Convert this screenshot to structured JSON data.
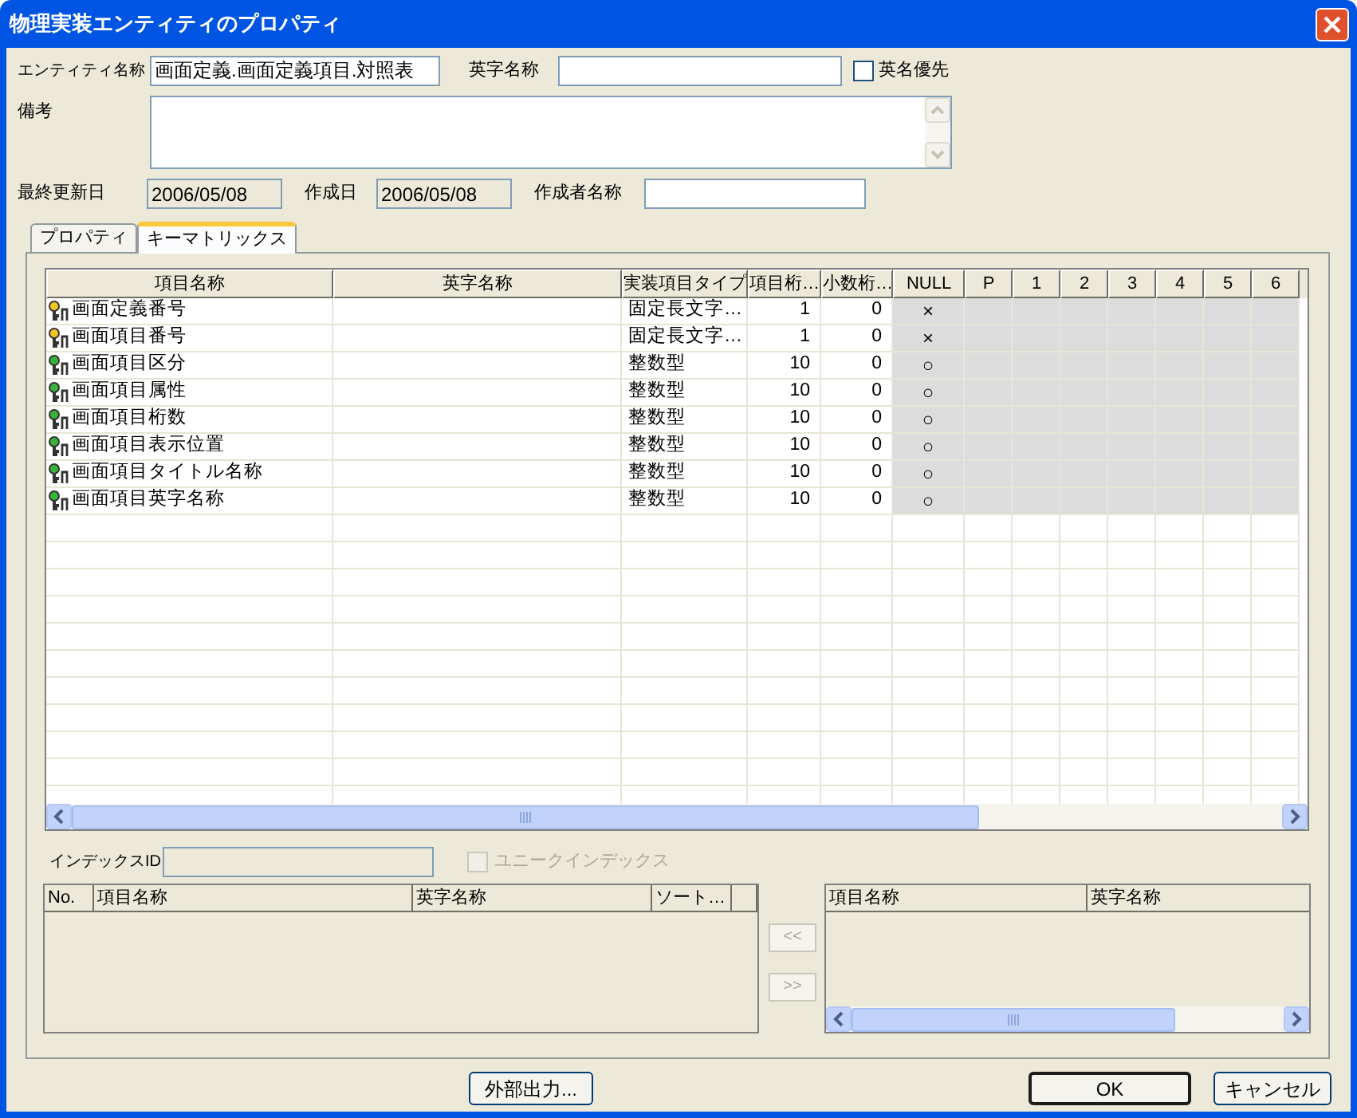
{
  "window": {
    "title": "物理実装エンティティのプロパティ"
  },
  "entity_name": {
    "label": "エンティティ名称",
    "value": "画面定義.画面定義項目.対照表"
  },
  "english_name": {
    "label": "英字名称"
  },
  "english_priority": {
    "label": "英名優先",
    "checked": false
  },
  "remarks": {
    "label": "備考"
  },
  "last_updated": {
    "label": "最終更新日",
    "value": "2006/05/08"
  },
  "created": {
    "label": "作成日",
    "value": "2006/05/08"
  },
  "author": {
    "label": "作成者名称"
  },
  "tabs": [
    {
      "label": "プロパティ",
      "selected": false
    },
    {
      "label": "キーマトリックス",
      "selected": true
    }
  ],
  "key_matrix": {
    "columns": [
      "項目名称",
      "英字名称",
      "実装項目タイプ",
      "項目桁…",
      "小数桁…",
      "NULL",
      "P",
      "1",
      "2",
      "3",
      "4",
      "5",
      "6"
    ],
    "rows": [
      {
        "kind": "primary_key",
        "name": "画面定義番号",
        "type": "固定長文字…",
        "length": "1",
        "decimals": "0",
        "null": "×"
      },
      {
        "kind": "primary_key",
        "name": "画面項目番号",
        "type": "固定長文字…",
        "length": "1",
        "decimals": "0",
        "null": "×"
      },
      {
        "kind": "attribute",
        "name": "画面項目区分",
        "type": "整数型",
        "length": "10",
        "decimals": "0",
        "null": "○"
      },
      {
        "kind": "attribute",
        "name": "画面項目属性",
        "type": "整数型",
        "length": "10",
        "decimals": "0",
        "null": "○"
      },
      {
        "kind": "attribute",
        "name": "画面項目桁数",
        "type": "整数型",
        "length": "10",
        "decimals": "0",
        "null": "○"
      },
      {
        "kind": "attribute",
        "name": "画面項目表示位置",
        "type": "整数型",
        "length": "10",
        "decimals": "0",
        "null": "○"
      },
      {
        "kind": "attribute",
        "name": "画面項目タイトル名称",
        "type": "整数型",
        "length": "10",
        "decimals": "0",
        "null": "○"
      },
      {
        "kind": "attribute",
        "name": "画面項目英字名称",
        "type": "整数型",
        "length": "10",
        "decimals": "0",
        "null": "○"
      }
    ]
  },
  "index": {
    "label": "インデックスID",
    "disabled": true,
    "unique": {
      "label": "ユニークインデックス",
      "checked": false,
      "disabled": true
    },
    "columns": [
      "No.",
      "項目名称",
      "英字名称",
      "ソート…"
    ]
  },
  "move_buttons": [
    {
      "label": "<<",
      "disabled": true
    },
    {
      "label": ">>",
      "disabled": true
    }
  ],
  "available_columns": {
    "columns": [
      "項目名称",
      "英字名称"
    ]
  },
  "footer_buttons": [
    {
      "label": "外部出力...",
      "default": false
    },
    {
      "label": "OK",
      "default": true
    },
    {
      "label": "キャンセル",
      "default": false
    }
  ]
}
